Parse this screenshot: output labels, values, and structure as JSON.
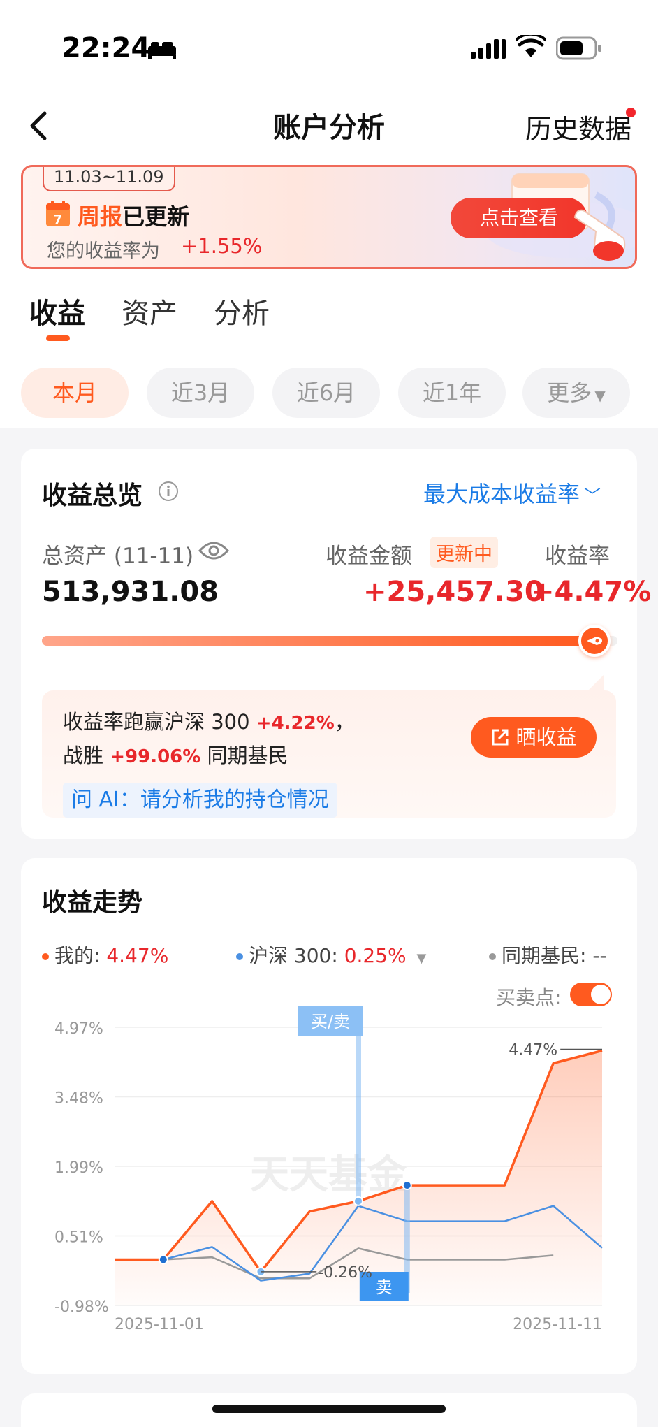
{
  "status_bar": {
    "time": "22:24"
  },
  "nav": {
    "title": "账户分析",
    "history_label": "历史数据"
  },
  "banner": {
    "date_range": "11.03~11.09",
    "calendar_day": "7",
    "title_highlight": "周报",
    "title_rest": "已更新",
    "subtitle": "您的收益率为",
    "rate": "+1.55%",
    "button_label": "点击查看"
  },
  "tabs": [
    {
      "label": "收益",
      "active": true
    },
    {
      "label": "资产",
      "active": false
    },
    {
      "label": "分析",
      "active": false
    }
  ],
  "periods": [
    {
      "label": "本月",
      "active": true
    },
    {
      "label": "近3月",
      "active": false
    },
    {
      "label": "近6月",
      "active": false
    },
    {
      "label": "近1年",
      "active": false
    },
    {
      "label": "更多",
      "active": false
    }
  ],
  "overview": {
    "title": "收益总览",
    "rate_type": "最大成本收益率",
    "total_assets_label": "总资产 (11-11)",
    "total_assets": "513,931.08",
    "profit_label": "收益金额",
    "updating_badge": "更新中",
    "profit_value": "+25,457.30",
    "rate_label": "收益率",
    "rate_value": "+4.47%",
    "progress_fraction": 0.96,
    "compare_line1_pre": "收益率跑赢沪深 300",
    "compare_line1_val": "+4.22%",
    "compare_line1_post": "，",
    "compare_line2_pre": "战胜",
    "compare_line2_val": "+99.06%",
    "compare_line2_post": "同期基民",
    "share_label": "晒收益",
    "ai_prompt": "问 AI：请分析我的持仓情况"
  },
  "trend": {
    "title": "收益走势",
    "legend_mine_label": "我的: ",
    "legend_mine_value": "4.47%",
    "legend_hs_label": "沪深 300: ",
    "legend_hs_value": "0.25%",
    "legend_peer_label": "同期基民: ",
    "legend_peer_value": "--",
    "buy_sell_toggle_label": "买卖点:",
    "buy_sell_enabled": true,
    "watermark": "天天基金",
    "marker_buy_sell": "买/卖",
    "marker_sell": "卖",
    "label_end": "4.47%",
    "label_min": "-0.26%"
  },
  "chart_data": {
    "type": "line",
    "x": [
      "2025-11-01",
      "2025-11-02",
      "2025-11-03",
      "2025-11-04",
      "2025-11-05",
      "2025-11-06",
      "2025-11-07",
      "2025-11-08",
      "2025-11-09",
      "2025-11-10",
      "2025-11-11"
    ],
    "x_tick_labels": [
      "2025-11-01",
      "2025-11-11"
    ],
    "y_tick_labels": [
      "4.97%",
      "3.48%",
      "1.99%",
      "0.51%",
      "-0.98%"
    ],
    "ylim": [
      -0.98,
      4.97
    ],
    "series": [
      {
        "name": "我的",
        "color": "#ff5a1f",
        "values": [
          0.0,
          0.0,
          1.25,
          -0.26,
          1.03,
          1.25,
          1.59,
          1.59,
          1.59,
          4.2,
          4.47
        ]
      },
      {
        "name": "沪深 300",
        "color": "#4a90e2",
        "values": [
          0.0,
          0.0,
          0.27,
          -0.45,
          -0.3,
          1.15,
          0.82,
          0.82,
          0.82,
          1.15,
          0.25
        ]
      },
      {
        "name": "同期基民",
        "color": "#999999",
        "values": [
          0.0,
          0.0,
          0.05,
          -0.4,
          -0.4,
          0.24,
          0.0,
          0.0,
          0.0,
          0.09,
          null
        ]
      }
    ],
    "grid": true,
    "legend": "top"
  }
}
